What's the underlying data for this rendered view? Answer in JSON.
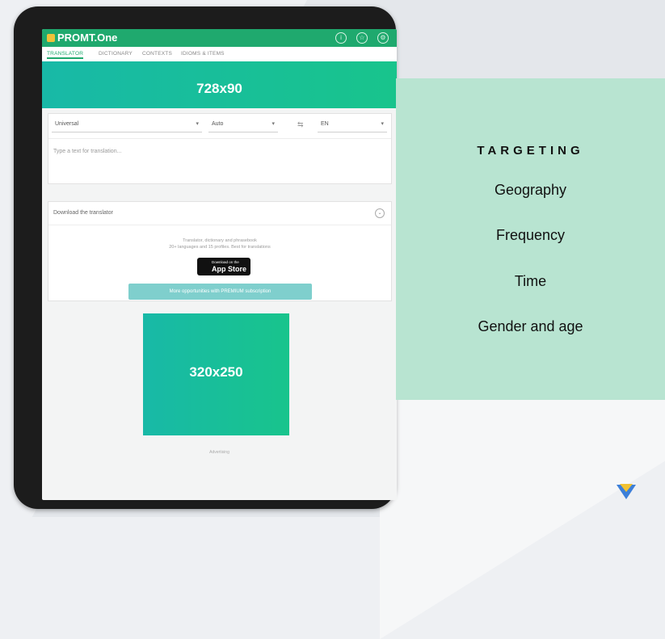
{
  "app": {
    "brand": "PROMT.One",
    "tabs": [
      "TRANSLATOR",
      "DICTIONARY",
      "CONTEXTS",
      "IDIOMS & ITEMS"
    ]
  },
  "translator": {
    "topic_select": "Universal",
    "source_lang": "Auto",
    "target_lang": "EN",
    "placeholder": "Type a text for translation..."
  },
  "download": {
    "title": "Download the translator",
    "line1": "Translator, dictionary and phrasebook",
    "line2": "20+ languages and 15 profiles. Best for translations",
    "appstore_small": "Download on the",
    "appstore_big": "App Store",
    "premium_button": "More opportunities with PREMIUM subscription"
  },
  "ads": {
    "top_banner": "728x90",
    "side_banner": "320x250",
    "footer": "Advertising"
  },
  "targeting": {
    "title": "TARGETING",
    "items": [
      "Geography",
      "Frequency",
      "Time",
      "Gender and age"
    ]
  },
  "colors": {
    "accent_green": "#1fa96e",
    "banner_gradient_start": "#18b9a7",
    "banner_gradient_end": "#18c48c",
    "targeting_bg": "#b8e4d1"
  }
}
